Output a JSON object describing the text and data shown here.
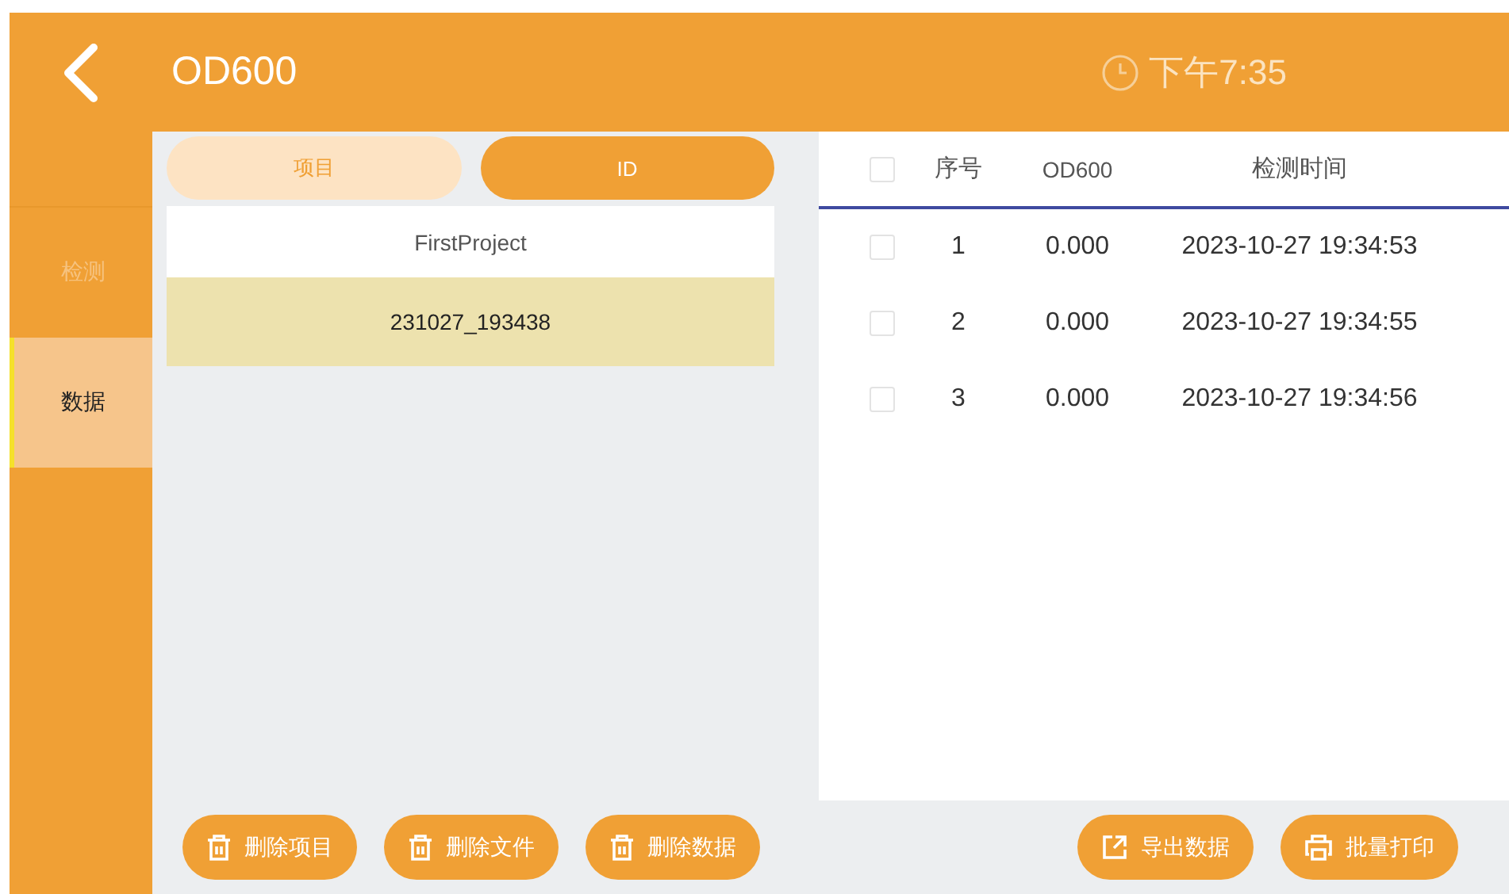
{
  "header": {
    "title": "OD600",
    "time": "下午7:35"
  },
  "sidebar": {
    "items": [
      {
        "label": "检测",
        "selected": false
      },
      {
        "label": "数据",
        "selected": true
      }
    ]
  },
  "tabs": [
    {
      "label": "项目",
      "selected": false
    },
    {
      "label": "ID",
      "selected": true
    }
  ],
  "list": [
    {
      "label": "FirstProject",
      "selected": false
    },
    {
      "label": "231027_193438",
      "selected": true
    }
  ],
  "left_buttons": [
    {
      "label": "删除项目",
      "kind": "trash"
    },
    {
      "label": "删除文件",
      "kind": "trash"
    },
    {
      "label": "删除数据",
      "kind": "trash"
    }
  ],
  "table": {
    "columns": [
      "序号",
      "OD600",
      "检测时间"
    ],
    "header_checked": false,
    "rows": [
      {
        "checked": false,
        "cells": [
          "1",
          "0.000",
          "2023-10-27 19:34:53"
        ]
      },
      {
        "checked": false,
        "cells": [
          "2",
          "0.000",
          "2023-10-27 19:34:55"
        ]
      },
      {
        "checked": false,
        "cells": [
          "3",
          "0.000",
          "2023-10-27 19:34:56"
        ]
      }
    ]
  },
  "right_buttons": [
    {
      "label": "导出数据",
      "kind": "export"
    },
    {
      "label": "批量打印",
      "kind": "print"
    }
  ]
}
